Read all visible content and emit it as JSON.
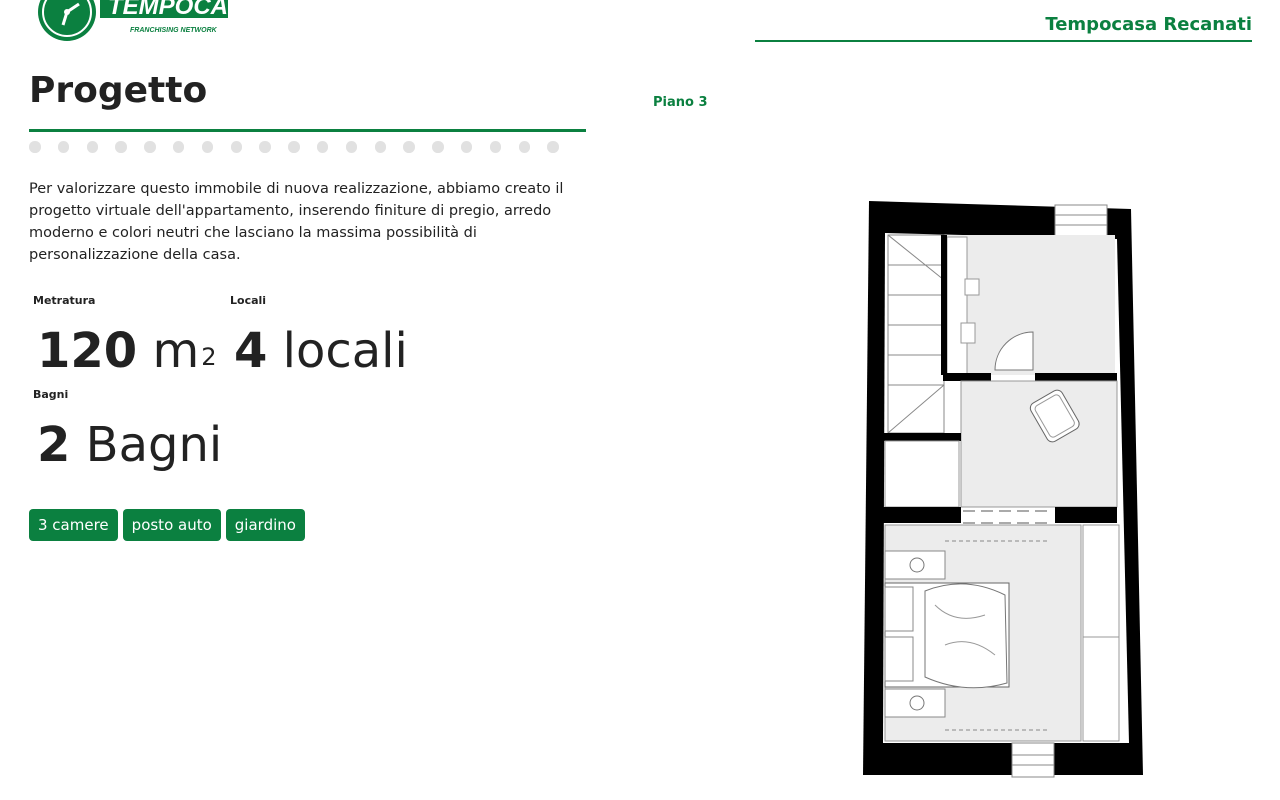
{
  "header": {
    "logo_text": "TEMPOCASA",
    "logo_subtitle": "FRANCHISING NETWORK",
    "agency_name": "Tempocasa Recanati"
  },
  "main": {
    "title": "Progetto",
    "description": "Per valorizzare questo immobile di nuova realizzazione, abbiamo creato il progetto virtuale dell'appartamento, inserendo finiture di pregio, arredo moderno e colori neutri che lasciano la massima possibilità di personalizzazione della casa.",
    "stats": {
      "area": {
        "label": "Metratura",
        "value": "120",
        "unit": "m",
        "unit_sup": "2"
      },
      "rooms": {
        "label": "Locali",
        "value": "4",
        "unit": "locali"
      },
      "baths": {
        "label": "Bagni",
        "value": "2",
        "unit": "Bagni"
      }
    },
    "tags": [
      "3 camere",
      "posto auto",
      "giardino"
    ]
  },
  "floorplan": {
    "floor_label": "Piano 3"
  },
  "colors": {
    "brand_green": "#0b8040",
    "dot_inactive": "#e1e1e1"
  },
  "icons": [
    "tempocasa-logo-icon",
    "floorplan-drawing"
  ]
}
